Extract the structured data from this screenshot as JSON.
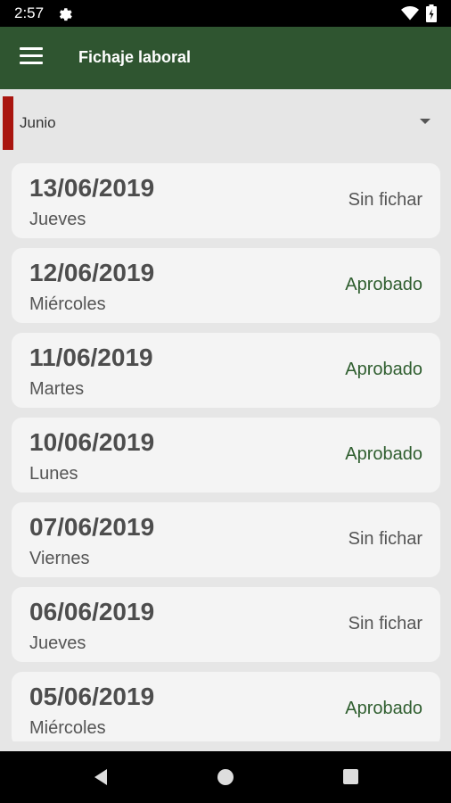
{
  "statusbar": {
    "time": "2:57"
  },
  "appbar": {
    "title": "Fichaje laboral"
  },
  "selector": {
    "value": "Junio"
  },
  "colors": {
    "approved": "#2f5e2f",
    "pending": "#555555",
    "primary": "#2f5530",
    "accent": "#a9150f"
  },
  "entries": [
    {
      "date": "13/06/2019",
      "day": "Jueves",
      "status": "Sin fichar",
      "kind": "pending"
    },
    {
      "date": "12/06/2019",
      "day": "Miércoles",
      "status": "Aprobado",
      "kind": "approved"
    },
    {
      "date": "11/06/2019",
      "day": "Martes",
      "status": "Aprobado",
      "kind": "approved"
    },
    {
      "date": "10/06/2019",
      "day": "Lunes",
      "status": "Aprobado",
      "kind": "approved"
    },
    {
      "date": "07/06/2019",
      "day": "Viernes",
      "status": "Sin fichar",
      "kind": "pending"
    },
    {
      "date": "06/06/2019",
      "day": "Jueves",
      "status": "Sin fichar",
      "kind": "pending"
    },
    {
      "date": "05/06/2019",
      "day": "Miércoles",
      "status": "Aprobado",
      "kind": "approved"
    }
  ]
}
